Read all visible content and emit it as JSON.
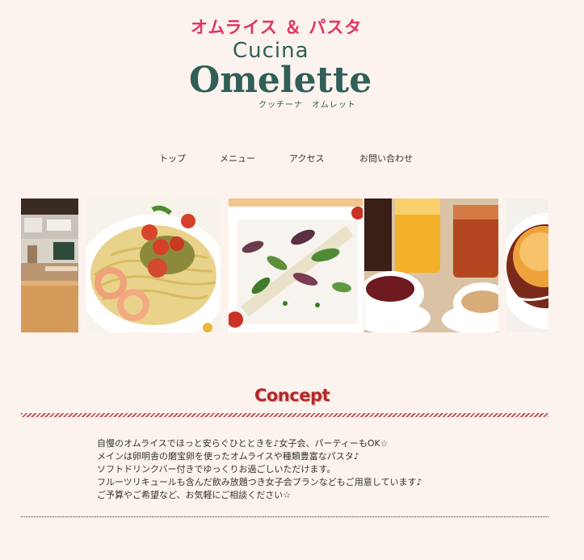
{
  "brand": {
    "tagline": "オムライス ＆ パスタ",
    "name_small": "Cucina",
    "name_large": "Omelette",
    "name_kana": "クッチーナ　オムレット",
    "colors": {
      "tagline": "#e03563",
      "logo": "#2f5f58",
      "background": "#fdf3ee"
    }
  },
  "nav": {
    "items": [
      {
        "label": "トップ"
      },
      {
        "label": "メニュー"
      },
      {
        "label": "アクセス"
      },
      {
        "label": "お問い合わせ"
      }
    ]
  },
  "gallery": {
    "photos": [
      {
        "icon": "restaurant-interior-photo"
      },
      {
        "icon": "shrimp-tomato-pasta-photo"
      },
      {
        "icon": "carpaccio-salad-photo"
      },
      {
        "icon": "drinks-photo"
      },
      {
        "icon": "omelette-rice-photo"
      }
    ]
  },
  "concept": {
    "title": "Concept",
    "lines": [
      "自慢のオムライスでほっと安らぐひとときを♪女子会、パーティーもOK☆",
      "メインは卵明舎の磨宝卵を使ったオムライスや種類豊富なパスタ♪",
      "ソフトドリンクバー付きでゆっくりお過ごしいただけます。",
      "フルーツリキュールも含んだ飲み放題つき女子会プランなどもご用意しています♪",
      "ご予算やご希望など、お気軽にご相談ください☆"
    ],
    "title_color": "#b02a2a"
  }
}
